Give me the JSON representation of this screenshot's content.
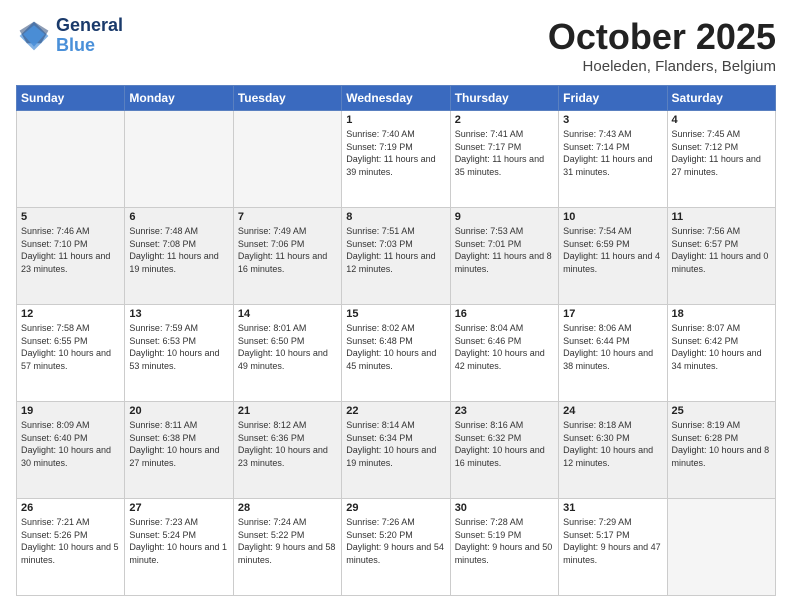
{
  "header": {
    "logo_line1": "General",
    "logo_line2": "Blue",
    "month": "October 2025",
    "location": "Hoeleden, Flanders, Belgium"
  },
  "weekdays": [
    "Sunday",
    "Monday",
    "Tuesday",
    "Wednesday",
    "Thursday",
    "Friday",
    "Saturday"
  ],
  "weeks": [
    [
      {
        "day": "",
        "empty": true
      },
      {
        "day": "",
        "empty": true
      },
      {
        "day": "",
        "empty": true
      },
      {
        "day": "1",
        "sunrise": "7:40 AM",
        "sunset": "7:19 PM",
        "daylight": "11 hours and 39 minutes."
      },
      {
        "day": "2",
        "sunrise": "7:41 AM",
        "sunset": "7:17 PM",
        "daylight": "11 hours and 35 minutes."
      },
      {
        "day": "3",
        "sunrise": "7:43 AM",
        "sunset": "7:14 PM",
        "daylight": "11 hours and 31 minutes."
      },
      {
        "day": "4",
        "sunrise": "7:45 AM",
        "sunset": "7:12 PM",
        "daylight": "11 hours and 27 minutes."
      }
    ],
    [
      {
        "day": "5",
        "sunrise": "7:46 AM",
        "sunset": "7:10 PM",
        "daylight": "11 hours and 23 minutes."
      },
      {
        "day": "6",
        "sunrise": "7:48 AM",
        "sunset": "7:08 PM",
        "daylight": "11 hours and 19 minutes."
      },
      {
        "day": "7",
        "sunrise": "7:49 AM",
        "sunset": "7:06 PM",
        "daylight": "11 hours and 16 minutes."
      },
      {
        "day": "8",
        "sunrise": "7:51 AM",
        "sunset": "7:03 PM",
        "daylight": "11 hours and 12 minutes."
      },
      {
        "day": "9",
        "sunrise": "7:53 AM",
        "sunset": "7:01 PM",
        "daylight": "11 hours and 8 minutes."
      },
      {
        "day": "10",
        "sunrise": "7:54 AM",
        "sunset": "6:59 PM",
        "daylight": "11 hours and 4 minutes."
      },
      {
        "day": "11",
        "sunrise": "7:56 AM",
        "sunset": "6:57 PM",
        "daylight": "11 hours and 0 minutes."
      }
    ],
    [
      {
        "day": "12",
        "sunrise": "7:58 AM",
        "sunset": "6:55 PM",
        "daylight": "10 hours and 57 minutes."
      },
      {
        "day": "13",
        "sunrise": "7:59 AM",
        "sunset": "6:53 PM",
        "daylight": "10 hours and 53 minutes."
      },
      {
        "day": "14",
        "sunrise": "8:01 AM",
        "sunset": "6:50 PM",
        "daylight": "10 hours and 49 minutes."
      },
      {
        "day": "15",
        "sunrise": "8:02 AM",
        "sunset": "6:48 PM",
        "daylight": "10 hours and 45 minutes."
      },
      {
        "day": "16",
        "sunrise": "8:04 AM",
        "sunset": "6:46 PM",
        "daylight": "10 hours and 42 minutes."
      },
      {
        "day": "17",
        "sunrise": "8:06 AM",
        "sunset": "6:44 PM",
        "daylight": "10 hours and 38 minutes."
      },
      {
        "day": "18",
        "sunrise": "8:07 AM",
        "sunset": "6:42 PM",
        "daylight": "10 hours and 34 minutes."
      }
    ],
    [
      {
        "day": "19",
        "sunrise": "8:09 AM",
        "sunset": "6:40 PM",
        "daylight": "10 hours and 30 minutes."
      },
      {
        "day": "20",
        "sunrise": "8:11 AM",
        "sunset": "6:38 PM",
        "daylight": "10 hours and 27 minutes."
      },
      {
        "day": "21",
        "sunrise": "8:12 AM",
        "sunset": "6:36 PM",
        "daylight": "10 hours and 23 minutes."
      },
      {
        "day": "22",
        "sunrise": "8:14 AM",
        "sunset": "6:34 PM",
        "daylight": "10 hours and 19 minutes."
      },
      {
        "day": "23",
        "sunrise": "8:16 AM",
        "sunset": "6:32 PM",
        "daylight": "10 hours and 16 minutes."
      },
      {
        "day": "24",
        "sunrise": "8:18 AM",
        "sunset": "6:30 PM",
        "daylight": "10 hours and 12 minutes."
      },
      {
        "day": "25",
        "sunrise": "8:19 AM",
        "sunset": "6:28 PM",
        "daylight": "10 hours and 8 minutes."
      }
    ],
    [
      {
        "day": "26",
        "sunrise": "7:21 AM",
        "sunset": "5:26 PM",
        "daylight": "10 hours and 5 minutes."
      },
      {
        "day": "27",
        "sunrise": "7:23 AM",
        "sunset": "5:24 PM",
        "daylight": "10 hours and 1 minute."
      },
      {
        "day": "28",
        "sunrise": "7:24 AM",
        "sunset": "5:22 PM",
        "daylight": "9 hours and 58 minutes."
      },
      {
        "day": "29",
        "sunrise": "7:26 AM",
        "sunset": "5:20 PM",
        "daylight": "9 hours and 54 minutes."
      },
      {
        "day": "30",
        "sunrise": "7:28 AM",
        "sunset": "5:19 PM",
        "daylight": "9 hours and 50 minutes."
      },
      {
        "day": "31",
        "sunrise": "7:29 AM",
        "sunset": "5:17 PM",
        "daylight": "9 hours and 47 minutes."
      },
      {
        "day": "",
        "empty": true
      }
    ]
  ]
}
